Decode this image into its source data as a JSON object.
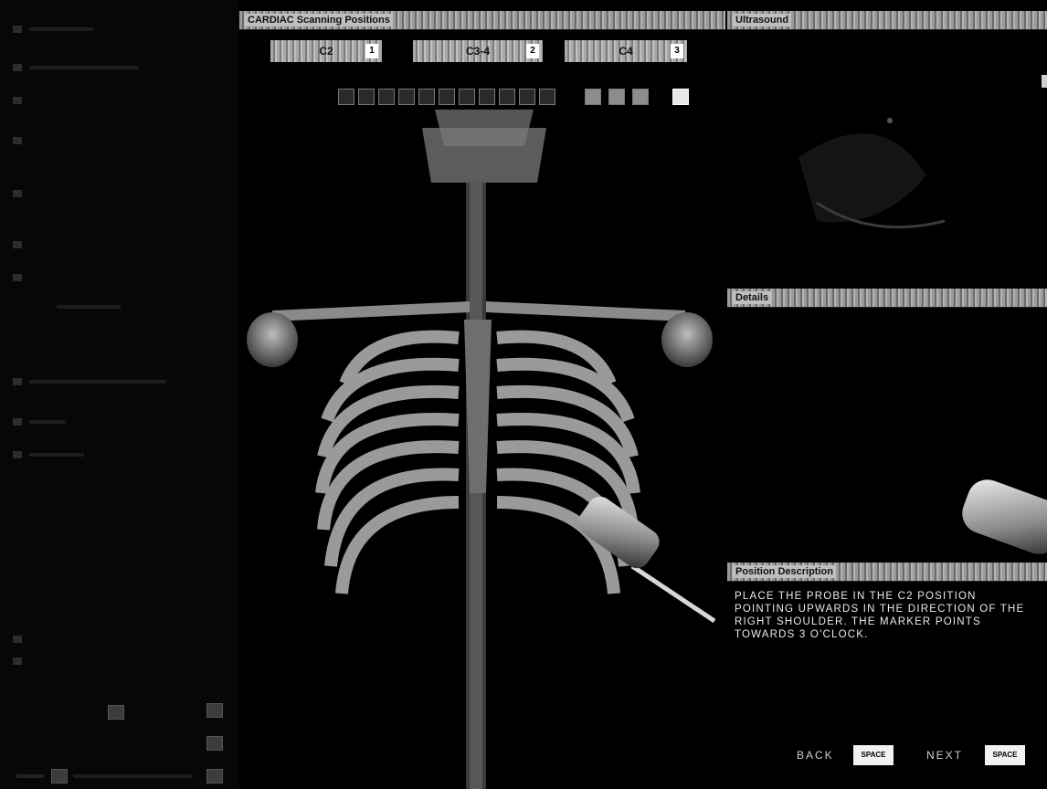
{
  "panels": {
    "cardiac": "CARDIAC Scanning Positions",
    "ultrasound": "Ultrasound",
    "details": "Details",
    "description": "Position Description"
  },
  "positions": [
    {
      "label": "C2",
      "num": "1"
    },
    {
      "label": "C3-4",
      "num": "2"
    },
    {
      "label": "C4",
      "num": "3"
    }
  ],
  "description_text": "Place the probe in the C2 position pointing upwards in the direction of the right shoulder. The marker points towards 3 o'clock.",
  "nav": {
    "back_label": "BACK",
    "back_key": "SPACE",
    "next_label": "NEXT",
    "next_key": "SPACE"
  },
  "colors": {
    "header": "#9a9a9a",
    "background": "#000000",
    "text": "#eaeaea"
  }
}
